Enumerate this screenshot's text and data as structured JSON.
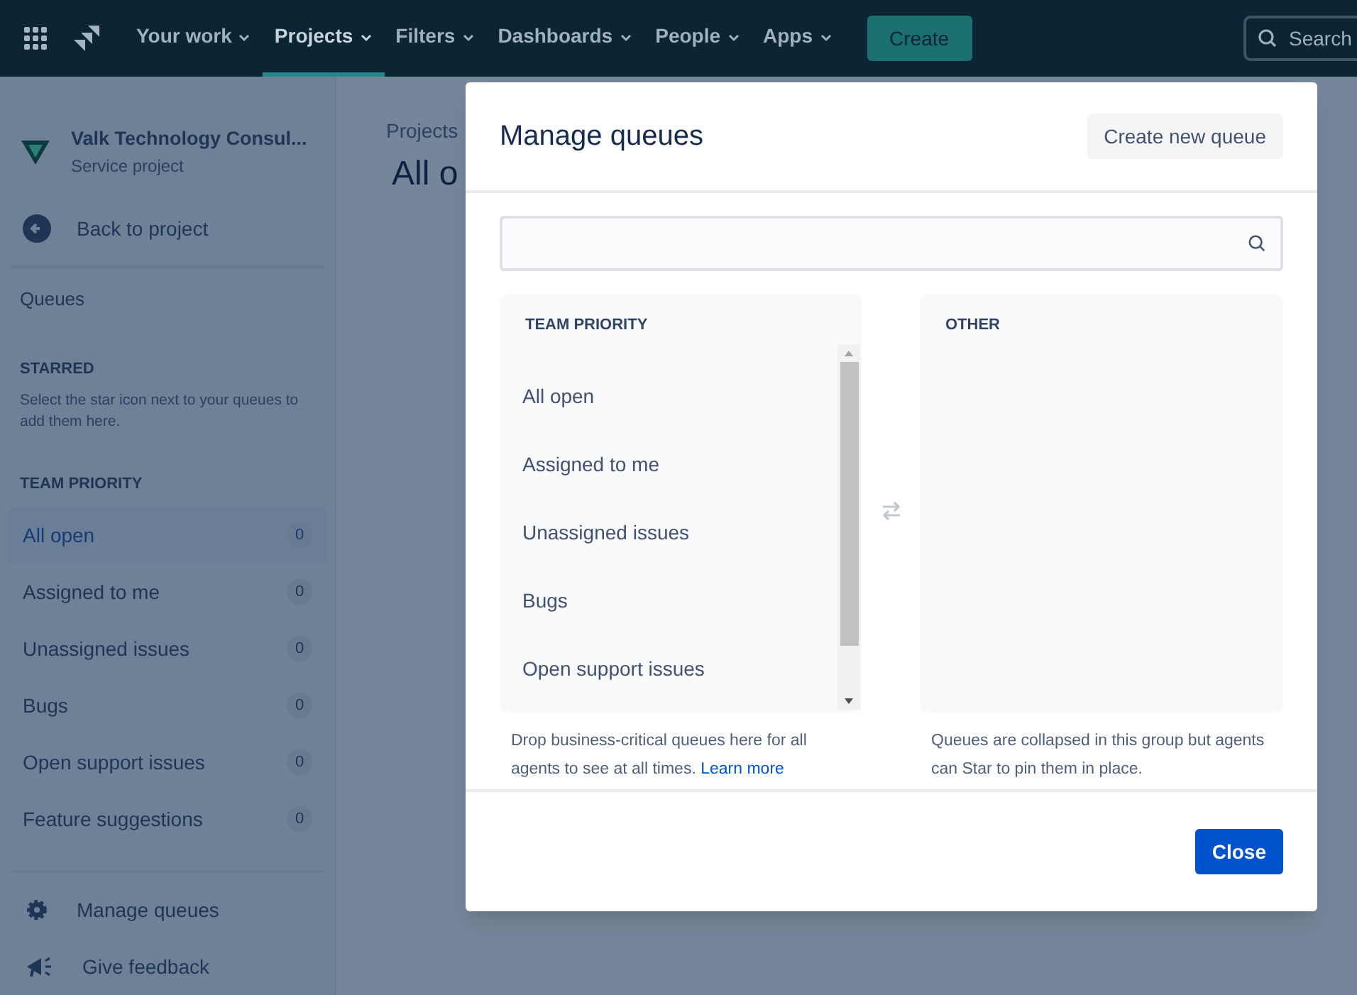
{
  "nav": {
    "items": [
      {
        "label": "Your work",
        "selected": false
      },
      {
        "label": "Projects",
        "selected": true
      },
      {
        "label": "Filters",
        "selected": false
      },
      {
        "label": "Dashboards",
        "selected": false
      },
      {
        "label": "People",
        "selected": false
      },
      {
        "label": "Apps",
        "selected": false
      }
    ],
    "create": "Create",
    "search": {
      "placeholder": "Search"
    }
  },
  "sidebar": {
    "project_name": "Valk Technology Consul...",
    "project_type": "Service project",
    "back": "Back to project",
    "queues_heading": "Queues",
    "starred_heading": "STARRED",
    "starred_hint": "Select the star icon next to your queues to add them here.",
    "team_heading": "TEAM PRIORITY",
    "items": [
      {
        "label": "All open",
        "count": "0",
        "selected": true
      },
      {
        "label": "Assigned to me",
        "count": "0",
        "selected": false
      },
      {
        "label": "Unassigned issues",
        "count": "0",
        "selected": false
      },
      {
        "label": "Bugs",
        "count": "0",
        "selected": false
      },
      {
        "label": "Open support issues",
        "count": "0",
        "selected": false
      },
      {
        "label": "Feature suggestions",
        "count": "0",
        "selected": false
      }
    ],
    "footer": [
      {
        "kind": "gear",
        "label": "Manage queues"
      },
      {
        "kind": "megaphone",
        "label": "Give feedback"
      }
    ]
  },
  "main": {
    "breadcrumb": "Projects",
    "title": "All o"
  },
  "dialog": {
    "title": "Manage queues",
    "create_button": "Create new queue",
    "team": {
      "heading": "TEAM PRIORITY",
      "items": [
        "All open",
        "Assigned to me",
        "Unassigned issues",
        "Bugs",
        "Open support issues"
      ],
      "note": "Drop business-critical queues here for all agents to see at all times.",
      "link": "Learn more"
    },
    "other": {
      "heading": "OTHER",
      "note": "Queues are collapsed in this group but agents can Star to pin them in place."
    },
    "close_button": "Close"
  }
}
